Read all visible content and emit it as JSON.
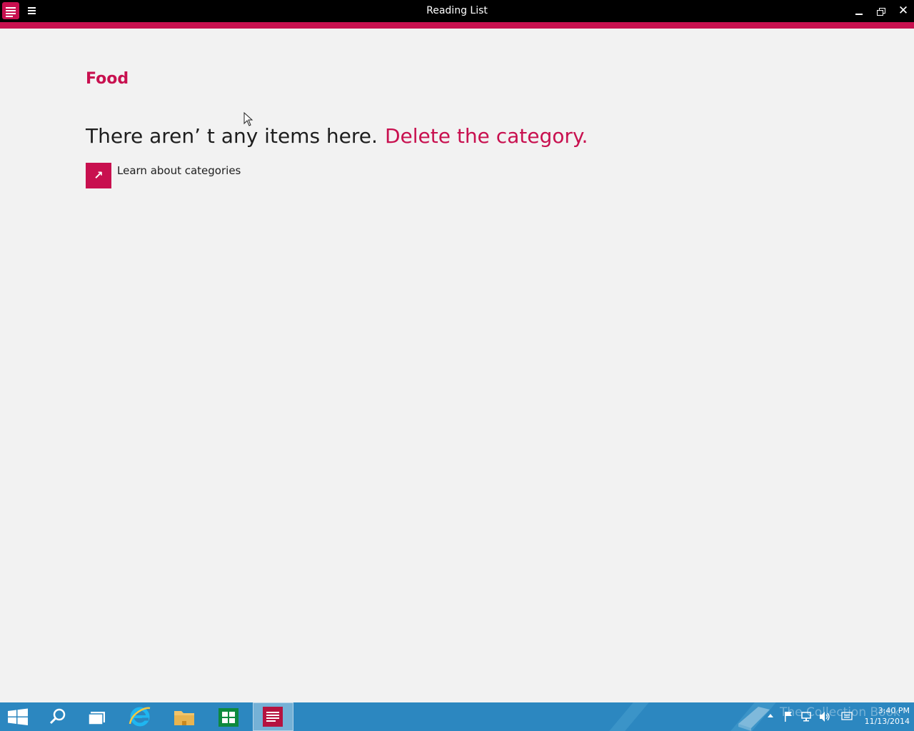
{
  "window": {
    "title": "Reading List",
    "accent_color": "#c8104f"
  },
  "titlebar": {
    "app_icon": "reading-list-icon",
    "menu_icon": "hamburger-menu-icon",
    "minimize_icon": "minimize-icon",
    "restore_icon": "restore-icon",
    "close_label": "✕"
  },
  "content": {
    "category_title": "Food",
    "empty_message": "There aren’ t any items here.",
    "delete_link": "Delete the category.",
    "learn_icon": "↗",
    "learn_label": "Learn about categories"
  },
  "taskbar": {
    "color": "#2c87c0",
    "items": [
      {
        "icon": "windows-start-icon"
      },
      {
        "icon": "search-icon"
      },
      {
        "icon": "task-view-icon"
      },
      {
        "icon": "internet-explorer-icon"
      },
      {
        "icon": "file-explorer-icon"
      },
      {
        "icon": "store-icon"
      },
      {
        "icon": "reading-list-icon",
        "active": true
      }
    ],
    "tray_icons": [
      "show-hidden-icons-icon",
      "action-center-flag-icon",
      "network-icon",
      "volume-icon",
      "keyboard-icon"
    ],
    "watermark_text": "The Collection Book",
    "clock_time": "3:40 PM",
    "clock_date": "11/13/2014"
  }
}
